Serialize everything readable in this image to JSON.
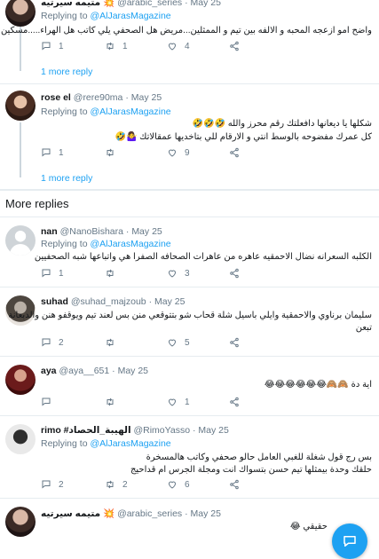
{
  "more_replies_title": "More replies",
  "show_more_label": "1 more reply",
  "tweets": [
    {
      "name": "متيمه سيرتيه 💥",
      "handle": "@arabic_series",
      "time": "May 25",
      "replying_prefix": "Replying to",
      "replying_to": "@AlJarasMagazine",
      "text_lines": [
        "واضح امو ازعجه المحبه و الالفه بين تيم و الممثلين...مريض هل الصحفي يلي كاتب هل الهراء.....مسكين"
      ],
      "replies": "1",
      "retweets": "1",
      "likes": "4"
    },
    {
      "name": "rose el",
      "handle": "@rere90ma",
      "time": "May 25",
      "replying_prefix": "Replying to",
      "replying_to": "@AlJarasMagazine",
      "text_lines": [
        "شكلها يا ديعانها دافعلتك رقم محرز والله 🤣🤣🤣",
        "كل عمرك مفضوحه بالوسط انتي و الارقام للي بتاخديها عمقالاتك 🤷‍♀️🤣"
      ],
      "replies": "1",
      "retweets": "",
      "likes": "9"
    },
    {
      "name": "nan",
      "handle": "@NanoBishara",
      "time": "May 25",
      "replying_prefix": "Replying to",
      "replying_to": "@AlJarasMagazine",
      "text_lines": [
        "الكلبه السعرانه نضال الاحمقيه عاهره من عاهرات الصحافه الصفرا هي واتباعها شبه الصحفيين"
      ],
      "replies": "1",
      "retweets": "",
      "likes": "3"
    },
    {
      "name": "suhad",
      "handle": "@suhad_majzoub",
      "time": "May 25",
      "replying_prefix": "",
      "replying_to": "",
      "text_lines": [
        "سليمان برناوي والاحمقية وايلي باسيل شلة قحاب شو بتتوقعي منن بس لعند تيم ويوقفو هنن والدبعانة",
        "تبعن"
      ],
      "replies": "2",
      "retweets": "",
      "likes": "5"
    },
    {
      "name": "aya",
      "handle": "@aya__651",
      "time": "May 25",
      "replying_prefix": "",
      "replying_to": "",
      "text_lines": [
        "اية دة 🙈🙈😂😂😂😂😂😂"
      ],
      "replies": "",
      "retweets": "",
      "likes": "1"
    },
    {
      "name": "rimo #الهيبة_الحصاد",
      "handle": "@RimoYasso",
      "time": "May 25",
      "replying_prefix": "Replying to",
      "replying_to": "@AlJarasMagazine",
      "text_lines": [
        "بس رج قول شغلة للغبي العامل حالو صحفي وكاتب هالمسخرة",
        "حلقك وحدة بيمثلها تيم حسن بتسواك انت ومجلة الجرس ام قداحيج"
      ],
      "replies": "2",
      "retweets": "2",
      "likes": "6"
    },
    {
      "name": "متيمه سيرتيه 💥",
      "handle": "@arabic_series",
      "time": "May 25",
      "replying_prefix": "",
      "replying_to": "",
      "text_lines": [
        "حقيقي 😂"
      ],
      "replies": "",
      "retweets": "",
      "likes": ""
    }
  ]
}
